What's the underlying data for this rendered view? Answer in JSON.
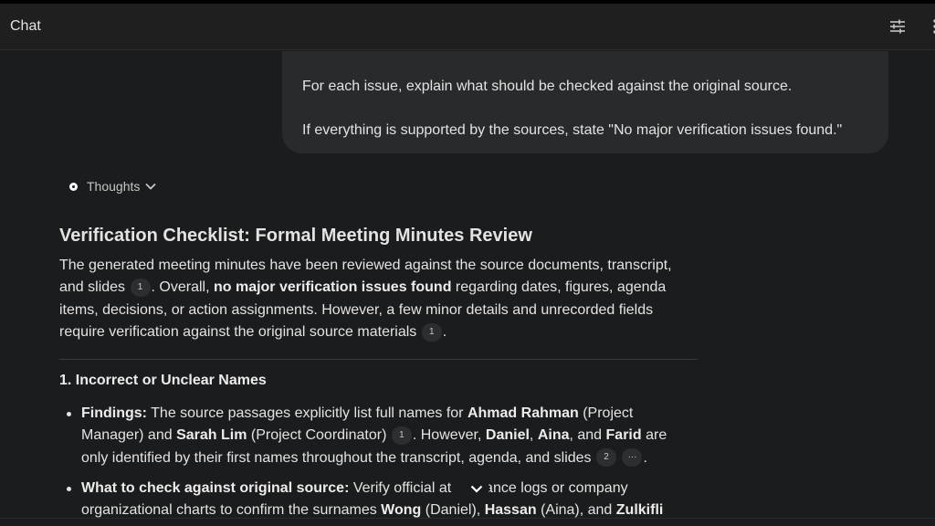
{
  "header": {
    "title": "Chat",
    "icons": [
      "tune-icon"
    ]
  },
  "user_message": {
    "line1": "For each issue, explain what should be checked against the original source.",
    "line2": "If everything is supported by the sources, state \"No major verification issues found.\""
  },
  "thoughts": {
    "label": "Thoughts",
    "icon": "chevron-down-icon"
  },
  "response": {
    "heading": "Verification Checklist: Formal Meeting Minutes Review",
    "intro": {
      "l1": "The generated meeting minutes have been reviewed against the source documents, transcript,",
      "l2_a": "and slides",
      "cite1": "1",
      "l2_b": ". Overall,",
      "l2_bold": "no major verification issues found",
      "l2_c": "regarding dates, figures, agenda",
      "l3": "items, decisions, or action assignments. However, a few minor details and unrecorded fields",
      "l4_a": "require verification against the original source materials",
      "cite2": "1",
      "l4_b": "."
    },
    "section1_title": "1. Incorrect or Unclear Names",
    "bullet1": {
      "label": "Findings:",
      "l1_a": "The source passages explicitly list full names for",
      "name1": "Ahmad Rahman",
      "l1_b": "(Project",
      "l2_a": "Manager) and",
      "name2": "Sarah Lim",
      "l2_b": "(Project Coordinator)",
      "cite": "1",
      "l2_c": ". However,",
      "name3": "Daniel",
      "comma": ",",
      "name4": "Aina",
      "l2_d": ", and",
      "name5": "Farid",
      "l2_e": "are",
      "l3_a": "only identified by their first names throughout the transcript, agenda, and slides",
      "cite2": "2",
      "cite_more": "···",
      "l3_b": "."
    },
    "bullet2": {
      "label": "What to check against original source:",
      "l1_a": "Verify official at",
      "l1_b": "dance logs or company",
      "l2_a": "organizational charts to confirm the surnames",
      "name1": "Wong",
      "l2_b": "(Daniel),",
      "name2": "Hassan",
      "l2_c": "(Aina), and",
      "name3": "Zulkifli"
    }
  },
  "scroll_button_icon": "chevron-down-icon"
}
